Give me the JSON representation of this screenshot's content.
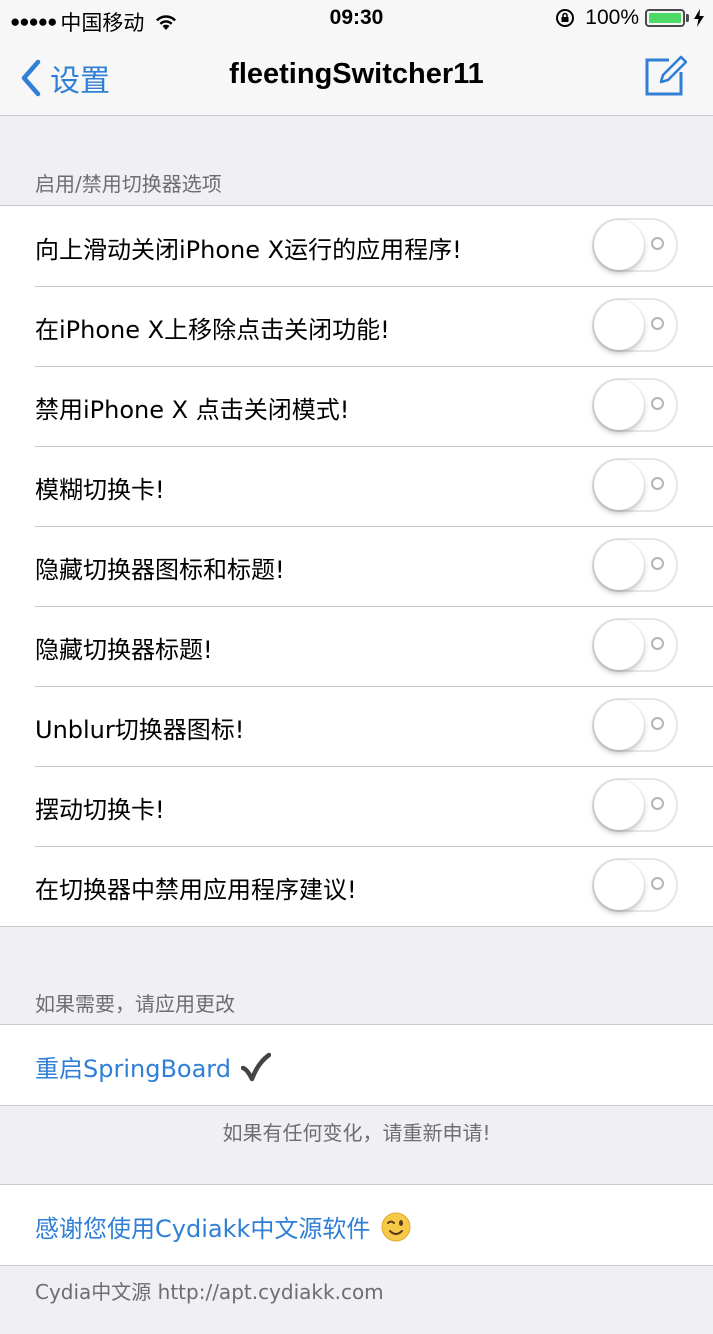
{
  "status_bar": {
    "signal_dots": "●●●●●",
    "carrier": "中国移动",
    "time": "09:30",
    "battery_text": "100%",
    "battery_level": 1.0,
    "battery_color": "#4cd964"
  },
  "nav": {
    "back_label": "设置",
    "title": "fleetingSwitcher11",
    "accent_color": "#2f7fd6"
  },
  "section1": {
    "header": "启用/禁用切换器选项",
    "rows": [
      {
        "label": "向上滑动关闭iPhone X运行的应用程序!",
        "on": false
      },
      {
        "label": "在iPhone X上移除点击关闭功能!",
        "on": false
      },
      {
        "label": "禁用iPhone X 点击关闭模式!",
        "on": false
      },
      {
        "label": "模糊切换卡!",
        "on": false
      },
      {
        "label": "隐藏切换器图标和标题!",
        "on": false
      },
      {
        "label": "隐藏切换器标题!",
        "on": false
      },
      {
        "label": "Unblur切换器图标!",
        "on": false
      },
      {
        "label": "摆动切换卡!",
        "on": false
      },
      {
        "label": "在切换器中禁用应用程序建议!",
        "on": false
      }
    ]
  },
  "section2": {
    "header": "如果需要，请应用更改",
    "respring_label": "重启SpringBoard",
    "footer": "如果有任何变化，请重新申请!"
  },
  "section3": {
    "thanks_label": "感谢您使用Cydiakk中文源软件",
    "footer": "Cydia中文源 http://apt.cydiakk.com"
  }
}
